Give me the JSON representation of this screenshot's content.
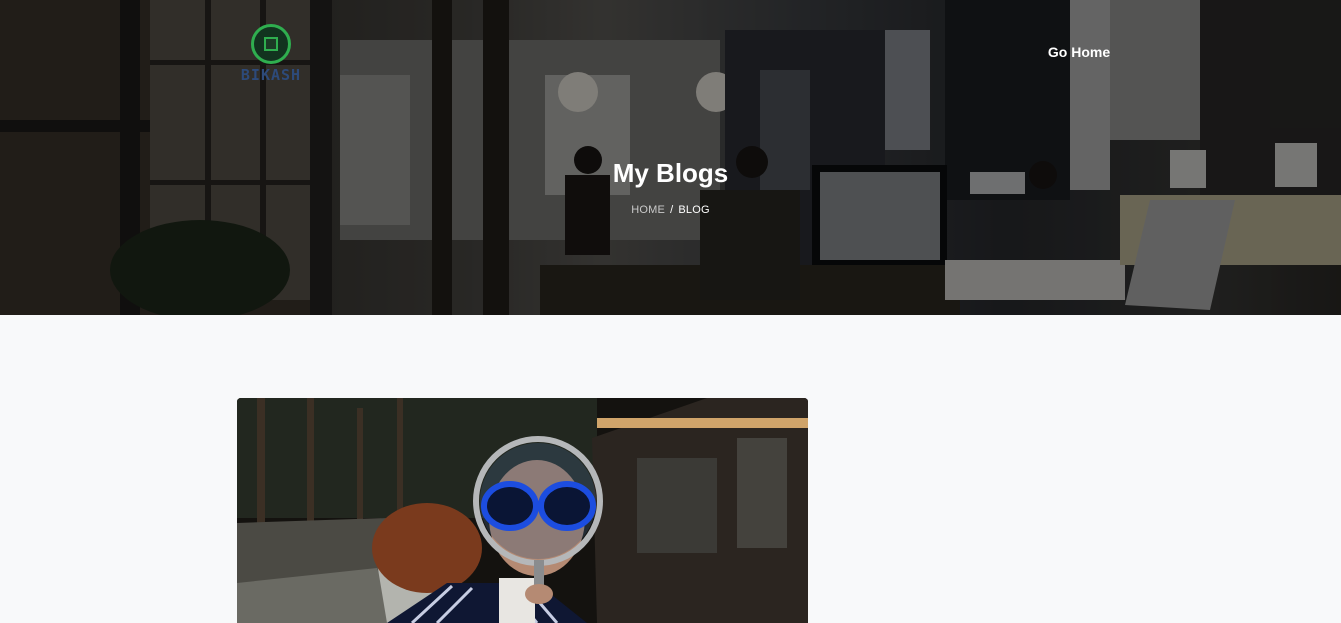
{
  "header": {
    "logo_text": "BIKASH",
    "nav_link": "Go Home"
  },
  "hero": {
    "title": "My Blogs",
    "breadcrumb": {
      "home": "HOME",
      "separator": "/",
      "current": "BLOG"
    }
  },
  "post": {
    "image_alt": ""
  },
  "colors": {
    "logo_green": "#2fae4f",
    "logo_text": "#2d4a7a",
    "page_background": "#f8f9fa"
  }
}
